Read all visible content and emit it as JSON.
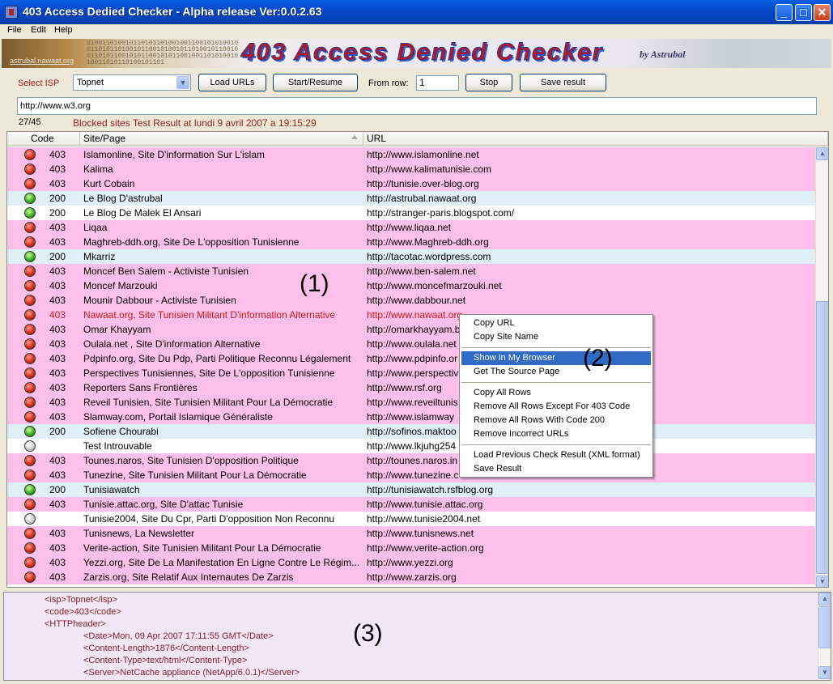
{
  "window": {
    "title": "403 Access Dedied Checker - Alpha release  Ver:0.0.2.63",
    "minimize": "_",
    "maximize": "□",
    "close": "✕"
  },
  "menu": [
    "File",
    "Edit",
    "Help"
  ],
  "banner": {
    "title": "403 Access Denied Checker",
    "by": "by Astrubal",
    "link": "astrubal.nawaat.org",
    "binary": "01001101001011010110100100110010101001001101011010010110010100101101001011001001101011001010110010101100100110101001010011010110100101101"
  },
  "toolbar": {
    "isp_label": "Select ISP",
    "isp_value": "Topnet",
    "load_urls": "Load URLs",
    "start_resume": "Start/Resume",
    "from_row_label": "From row:",
    "from_row_value": "1",
    "stop": "Stop",
    "save_result": "Save result"
  },
  "url_field": "http://www.w3.org",
  "progress": "27/45",
  "result_title": "Blocked sites Test Result at lundi 9 avril 2007 a 19:15:29",
  "columns": {
    "code": "Code",
    "site": "Site/Page",
    "url": "URL"
  },
  "rows": [
    {
      "status": "red",
      "code": "403",
      "site": "Islamonline, Site D'information Sur L'islam",
      "url": "http://www.islamonline.net"
    },
    {
      "status": "red",
      "code": "403",
      "site": "Kalima",
      "url": "http://www.kalimatunisie.com"
    },
    {
      "status": "red",
      "code": "403",
      "site": "Kurt Cobain",
      "url": "http://tunisie.over-blog.org"
    },
    {
      "status": "green",
      "code": "200",
      "site": "Le Blog D'astrubal",
      "url": "http://astrubal.nawaat.org"
    },
    {
      "status": "green",
      "code": "200",
      "site": "Le Blog De Malek El Ansari",
      "url": "http://stranger-paris.blogspot.com/",
      "plain": true
    },
    {
      "status": "red",
      "code": "403",
      "site": "Liqaa",
      "url": "http://www.liqaa.net"
    },
    {
      "status": "red",
      "code": "403",
      "site": "Maghreb-ddh.org, Site De L'opposition Tunisienne",
      "url": "http://www.Maghreb-ddh.org"
    },
    {
      "status": "green",
      "code": "200",
      "site": "Mkarriz",
      "url": "http://tacotac.wordpress.com"
    },
    {
      "status": "red",
      "code": "403",
      "site": "Moncef Ben Salem -  Activiste Tunisien",
      "url": "http://www.ben-salem.net"
    },
    {
      "status": "red",
      "code": "403",
      "site": "Moncef Marzouki",
      "url": "http://www.moncefmarzouki.net"
    },
    {
      "status": "red",
      "code": "403",
      "site": "Mounir Dabbour -  Activiste Tunisien",
      "url": "http://www.dabbour.net"
    },
    {
      "status": "red",
      "code": "403",
      "site": "Nawaat.org, Site Tunisien Militant D'information Alternative",
      "url": "http://www.nawaat.org",
      "highlight": true
    },
    {
      "status": "red",
      "code": "403",
      "site": "Omar Khayyam",
      "url": "http://omarkhayyam.b"
    },
    {
      "status": "red",
      "code": "403",
      "site": "Oulala.net , Site D'information Alternative",
      "url": "http://www.oulala.net"
    },
    {
      "status": "red",
      "code": "403",
      "site": "Pdpinfo.org,  Site Du Pdp, Parti Politique Reconnu Légalement",
      "url": "http://www.pdpinfo.or"
    },
    {
      "status": "red",
      "code": "403",
      "site": "Perspectives Tunisiennes, Site De L'opposition Tunisienne",
      "url": "http://www.perspectiv"
    },
    {
      "status": "red",
      "code": "403",
      "site": "Reporters Sans Frontières",
      "url": "http://www.rsf.org"
    },
    {
      "status": "red",
      "code": "403",
      "site": "Reveil Tunisien, Site Tunisien Militant Pour La Démocratie",
      "url": "http://www.reveiltunis"
    },
    {
      "status": "red",
      "code": "403",
      "site": "Slamway.com, Portail Islamique Généraliste",
      "url": "http://www.islamway"
    },
    {
      "status": "green",
      "code": "200",
      "site": "Sofiene Chourabi",
      "url": "http://sofinos.maktoo"
    },
    {
      "status": "grey",
      "code": "",
      "site": "Test Introuvable",
      "url": "http://www.lkjuhg254"
    },
    {
      "status": "red",
      "code": "403",
      "site": "Tounes.naros, Site Tunisien D'opposition Politique",
      "url": "http://tounes.naros.in"
    },
    {
      "status": "red",
      "code": "403",
      "site": "Tunezine,  Site Tunisien Militant Pour La Démocratie",
      "url": "http://www.tunezine.c"
    },
    {
      "status": "green",
      "code": "200",
      "site": "Tunisiawatch",
      "url": "http://tunisiawatch.rsfblog.org"
    },
    {
      "status": "red",
      "code": "403",
      "site": "Tunisie.attac.org, Site D'attac Tunisie",
      "url": "http://www.tunisie.attac.org"
    },
    {
      "status": "grey",
      "code": "",
      "site": "Tunisie2004,  Site Du Cpr, Parti D'opposition Non Reconnu",
      "url": "http://www.tunisie2004.net"
    },
    {
      "status": "red",
      "code": "403",
      "site": "Tunisnews, La Newsletter",
      "url": "http://www.tunisnews.net"
    },
    {
      "status": "red",
      "code": "403",
      "site": "Verite-action,  Site Tunisien Militant Pour La Démocratie",
      "url": "http://www.verite-action.org"
    },
    {
      "status": "red",
      "code": "403",
      "site": "Yezzi.org, Site De La Manifestation En Ligne Contre Le Régim...",
      "url": "http://www.yezzi.org"
    },
    {
      "status": "red",
      "code": "403",
      "site": "Zarzis.org, Site Relatif Aux Internautes De Zarzis",
      "url": "http://www.zarzis.org"
    }
  ],
  "annotations": {
    "a1": "(1)",
    "a2": "(2)",
    "a3": "(3)"
  },
  "context_menu": {
    "group1": [
      "Copy URL",
      "Copy Site Name"
    ],
    "group2": [
      "Show In My  Browser",
      "Get The Source Page"
    ],
    "group3": [
      "Copy All Rows",
      "Remove All Rows Except For 403 Code",
      "Remove All Rows With Code 200",
      "Remove Incorrect URLs"
    ],
    "group4": [
      "Load Previous Check Result (XML format)",
      "Save Result"
    ],
    "selected": "Show In My  Browser"
  },
  "xml_lines": [
    {
      "indent": 0,
      "text": "<isp>Topnet</isp>"
    },
    {
      "indent": 0,
      "text": "<code>403</code>"
    },
    {
      "indent": 0,
      "text": "<HTTPheader>"
    },
    {
      "indent": 1,
      "text": "<Date>Mon, 09 Apr 2007 17:11:55 GMT</Date>"
    },
    {
      "indent": 1,
      "text": "<Content-Length>1876</Content-Length>"
    },
    {
      "indent": 1,
      "text": "<Content-Type>text/html</Content-Type>"
    },
    {
      "indent": 1,
      "text": "<Server>NetCache appliance (NetApp/6.0.1)</Server>"
    }
  ]
}
